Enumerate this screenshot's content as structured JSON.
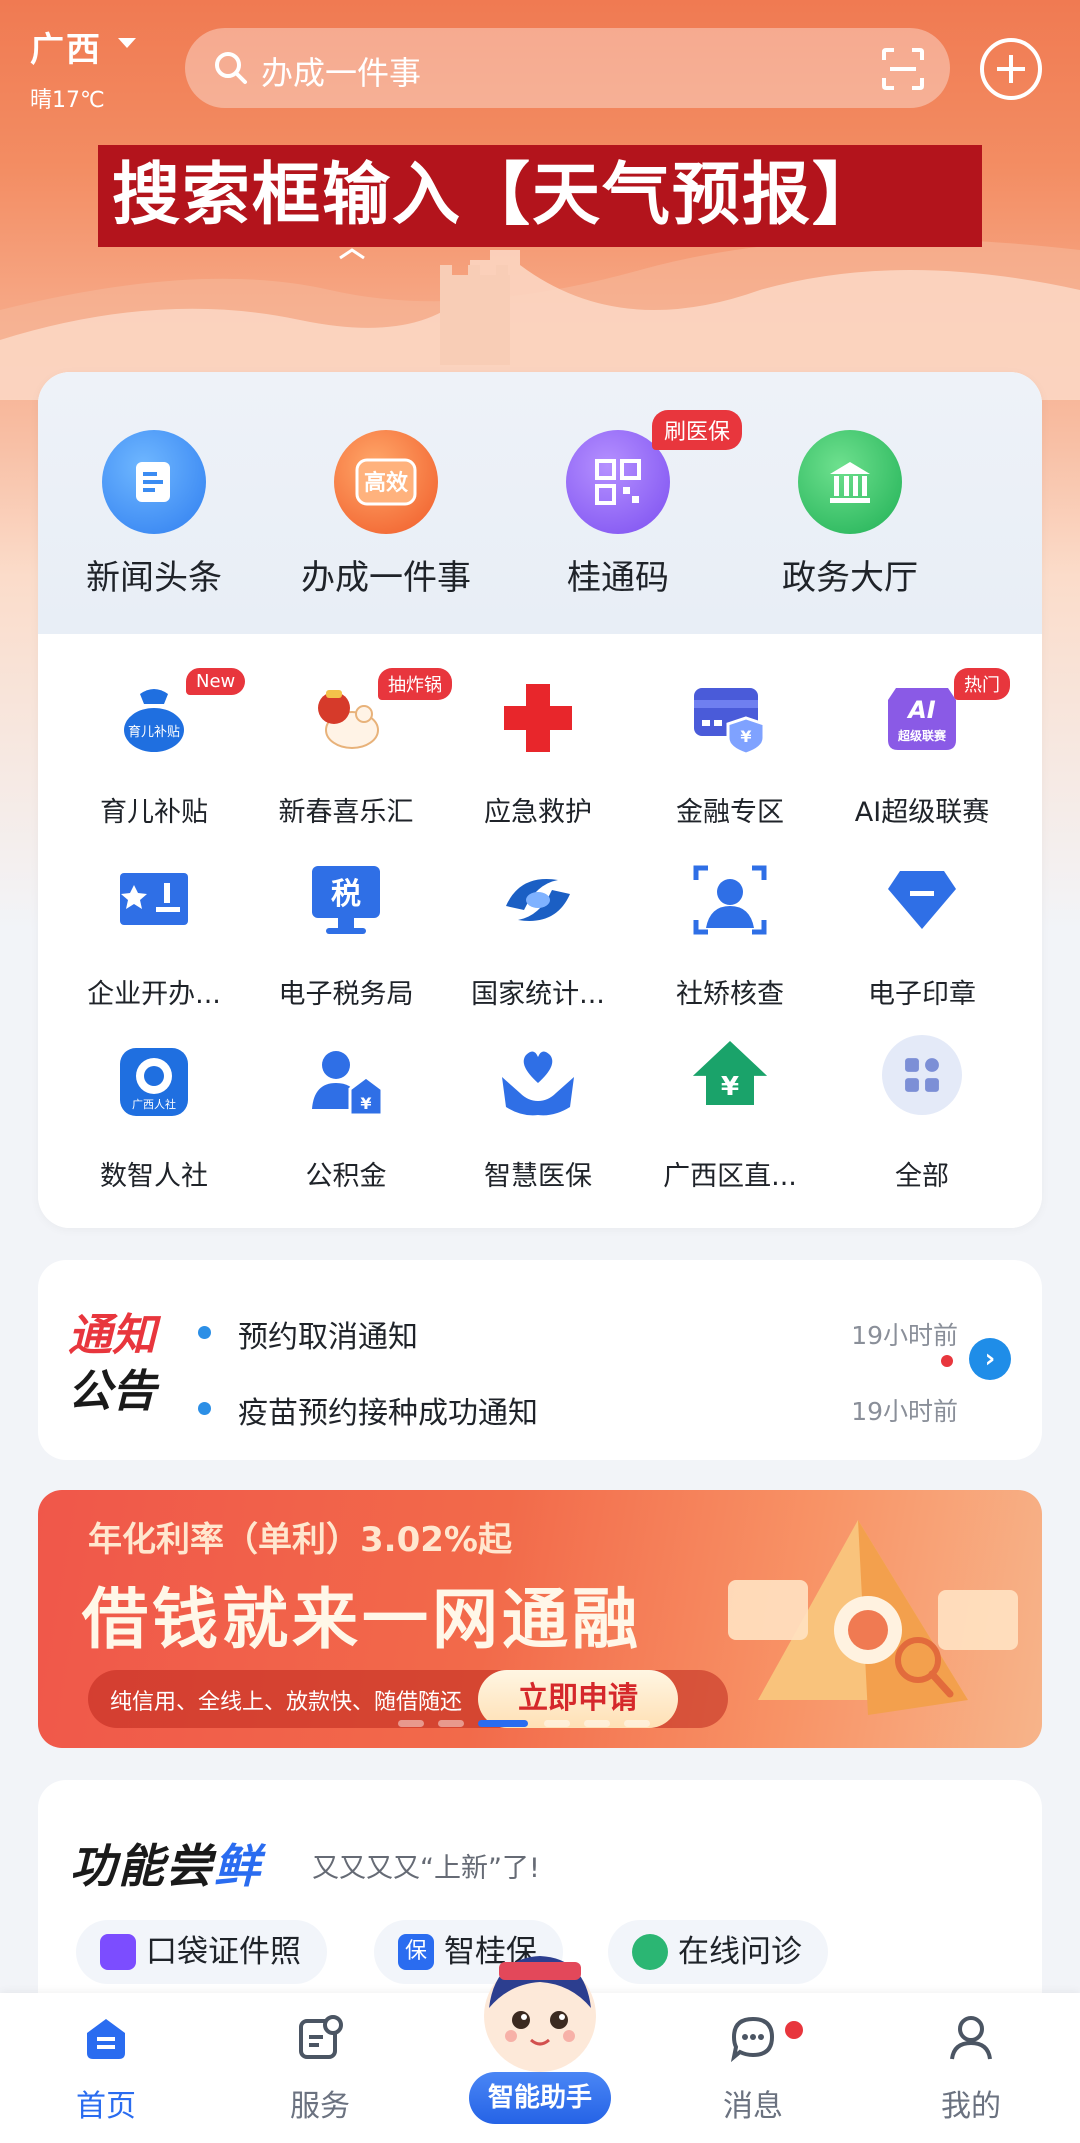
{
  "header": {
    "region": "广西",
    "weather": "晴17℃",
    "search_placeholder": "办成一件事"
  },
  "overlay_caption": "搜索框输入【天气预报】",
  "primary_services": [
    {
      "label": "新闻头条",
      "icon": "news-icon",
      "color": "#3b8cf2"
    },
    {
      "label": "办成一件事",
      "icon": "one-thing-icon",
      "color": "#f26b2c",
      "icon_text": "高效"
    },
    {
      "label": "桂通码",
      "icon": "qr-code-icon",
      "color": "#8b5cf6",
      "tag": "刷医保"
    },
    {
      "label": "政务大厅",
      "icon": "government-hall-icon",
      "color": "#22b55a"
    }
  ],
  "grid_services": [
    {
      "label": "育儿补贴",
      "icon": "childcare-subsidy-icon",
      "tag": "New",
      "icon_text": "育儿补贴"
    },
    {
      "label": "新春喜乐汇",
      "icon": "spring-festival-icon",
      "tag": "抽炸锅"
    },
    {
      "label": "应急救护",
      "icon": "red-cross-icon"
    },
    {
      "label": "金融专区",
      "icon": "finance-card-icon"
    },
    {
      "label": "AI超级联赛",
      "icon": "ai-league-icon",
      "tag": "热门",
      "icon_text": "超级联赛"
    },
    {
      "label": "企业开办...",
      "icon": "business-start-icon"
    },
    {
      "label": "电子税务局",
      "icon": "tax-bureau-icon",
      "icon_text": "税"
    },
    {
      "label": "国家统计...",
      "icon": "statistics-icon"
    },
    {
      "label": "社矫核查",
      "icon": "face-verify-icon"
    },
    {
      "label": "电子印章",
      "icon": "e-seal-icon"
    },
    {
      "label": "数智人社",
      "icon": "human-resources-icon",
      "icon_text": "广西人社"
    },
    {
      "label": "公积金",
      "icon": "housing-fund-icon"
    },
    {
      "label": "智慧医保",
      "icon": "medical-insurance-icon"
    },
    {
      "label": "广西区直...",
      "icon": "district-yuan-icon"
    },
    {
      "label": "全部",
      "icon": "all-apps-icon"
    }
  ],
  "notice": {
    "title_line1": "通知",
    "title_line2": "公告",
    "items": [
      {
        "text": "预约取消通知",
        "time": "19小时前"
      },
      {
        "text": "疫苗预约接种成功通知",
        "time": "19小时前"
      }
    ]
  },
  "promo": {
    "rate_text": "年化利率（单利）3.02%起",
    "headline": "借钱就来一网通融",
    "features": "纯信用、全线上、放款快、随借随还",
    "apply_label": "立即申请",
    "carousel_count": 6,
    "carousel_active": 3
  },
  "trial": {
    "title_main": "功能尝",
    "title_hl": "鲜",
    "subtitle": "又又又又“上新”了!",
    "chips": [
      {
        "label": "口袋证件照",
        "icon": "id-photo-icon",
        "color": "#7c4dff"
      },
      {
        "label": "智桂保",
        "icon": "insurance-icon",
        "color": "#2a6cf0",
        "icon_text": "保"
      },
      {
        "label": "在线问诊",
        "icon": "online-consult-icon",
        "color": "#2bb673"
      }
    ]
  },
  "tabbar": {
    "tabs": [
      {
        "label": "首页",
        "icon": "home-icon",
        "active": true
      },
      {
        "label": "服务",
        "icon": "service-icon"
      },
      {
        "label": "消息",
        "icon": "message-icon",
        "badge": true
      },
      {
        "label": "我的",
        "icon": "profile-icon"
      }
    ],
    "assistant_label": "智能助手"
  },
  "colors": {
    "accent": "#2a6cf0",
    "alert": "#e8363d",
    "hero_top": "#f07a52"
  }
}
